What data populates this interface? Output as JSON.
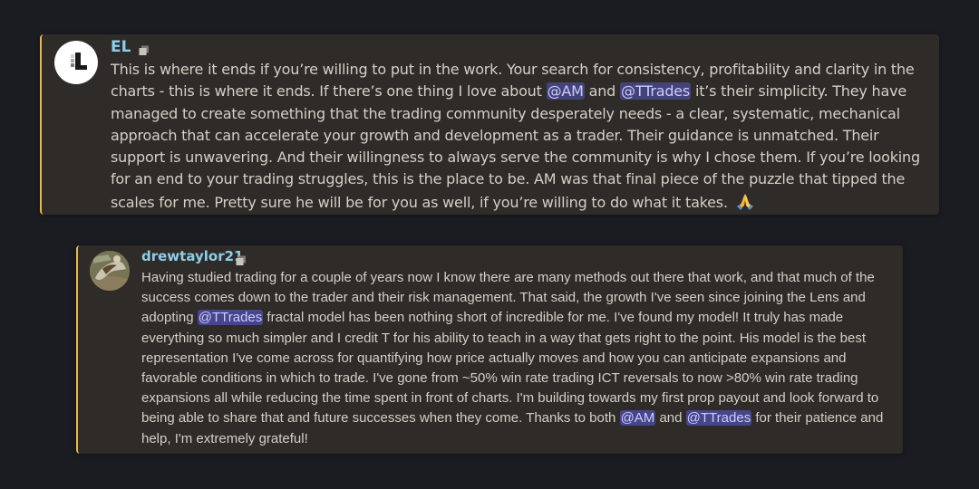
{
  "messages": [
    {
      "username": "EL",
      "avatar_icon": "el-logo-icon",
      "badge_icon": "server-tag-icon",
      "text": {
        "p1": "This is where it ends if you’re willing to put in the work. Your search for consistency, profitability and clarity in the charts - this is where it ends. If there’s one thing I love about ",
        "m1": "@AM",
        "p2": " and ",
        "m2": "@TTrades",
        "p3": " it’s their simplicity. They have managed to create something that the trading community desperately needs -  a clear, systematic, mechanical approach that can accelerate your growth and development as a trader. Their guidance is unmatched. Their support is unwavering. And their willingness to always serve the community is why I chose them. If you’re looking for an end to your trading struggles, this is the place to be. AM was that final piece of the puzzle that tipped the scales for me. Pretty sure he will be for you as well, if you’re willing to do what it takes. ",
        "emoji": "praying-hands-emoji"
      }
    },
    {
      "username": "drewtaylor21",
      "avatar_icon": "user-photo-avatar",
      "badge_icon": "server-tag-icon",
      "text": {
        "p1": "Having studied trading for a couple of years now I know there are many methods out there that work, and that much of the success comes down to the trader and their risk management.  That said, the growth I've seen since joining the Lens and adopting ",
        "m1": "@TTrades",
        "p2": " fractal model has been nothing short of incredible for me.  I've found my model! It truly has made everything so much simpler and I credit T for his ability to teach in a way that gets right to the point.  His model is the best representation I've come across for quantifying how price actually moves and how you can anticipate expansions and favorable conditions in which to trade.  I've gone from ~50% win rate trading ICT reversals to now  >80% win rate trading expansions all while reducing the time spent in front of charts.  I'm building towards my first prop payout and look forward to being able to share that and future successes when they come. Thanks to both ",
        "m2": "@AM",
        "p3": " and ",
        "m3": "@TTrades",
        "p4": " for their patience and help, I'm extremely grateful!"
      }
    }
  ],
  "colors": {
    "background": "#1b1b22",
    "card": "#2e2b28",
    "accent_border": "#e8b84a",
    "username": "#8ccfea",
    "body_text": "#d4d0c6",
    "mention_bg": "#444379",
    "mention_text": "#c9cdff"
  }
}
